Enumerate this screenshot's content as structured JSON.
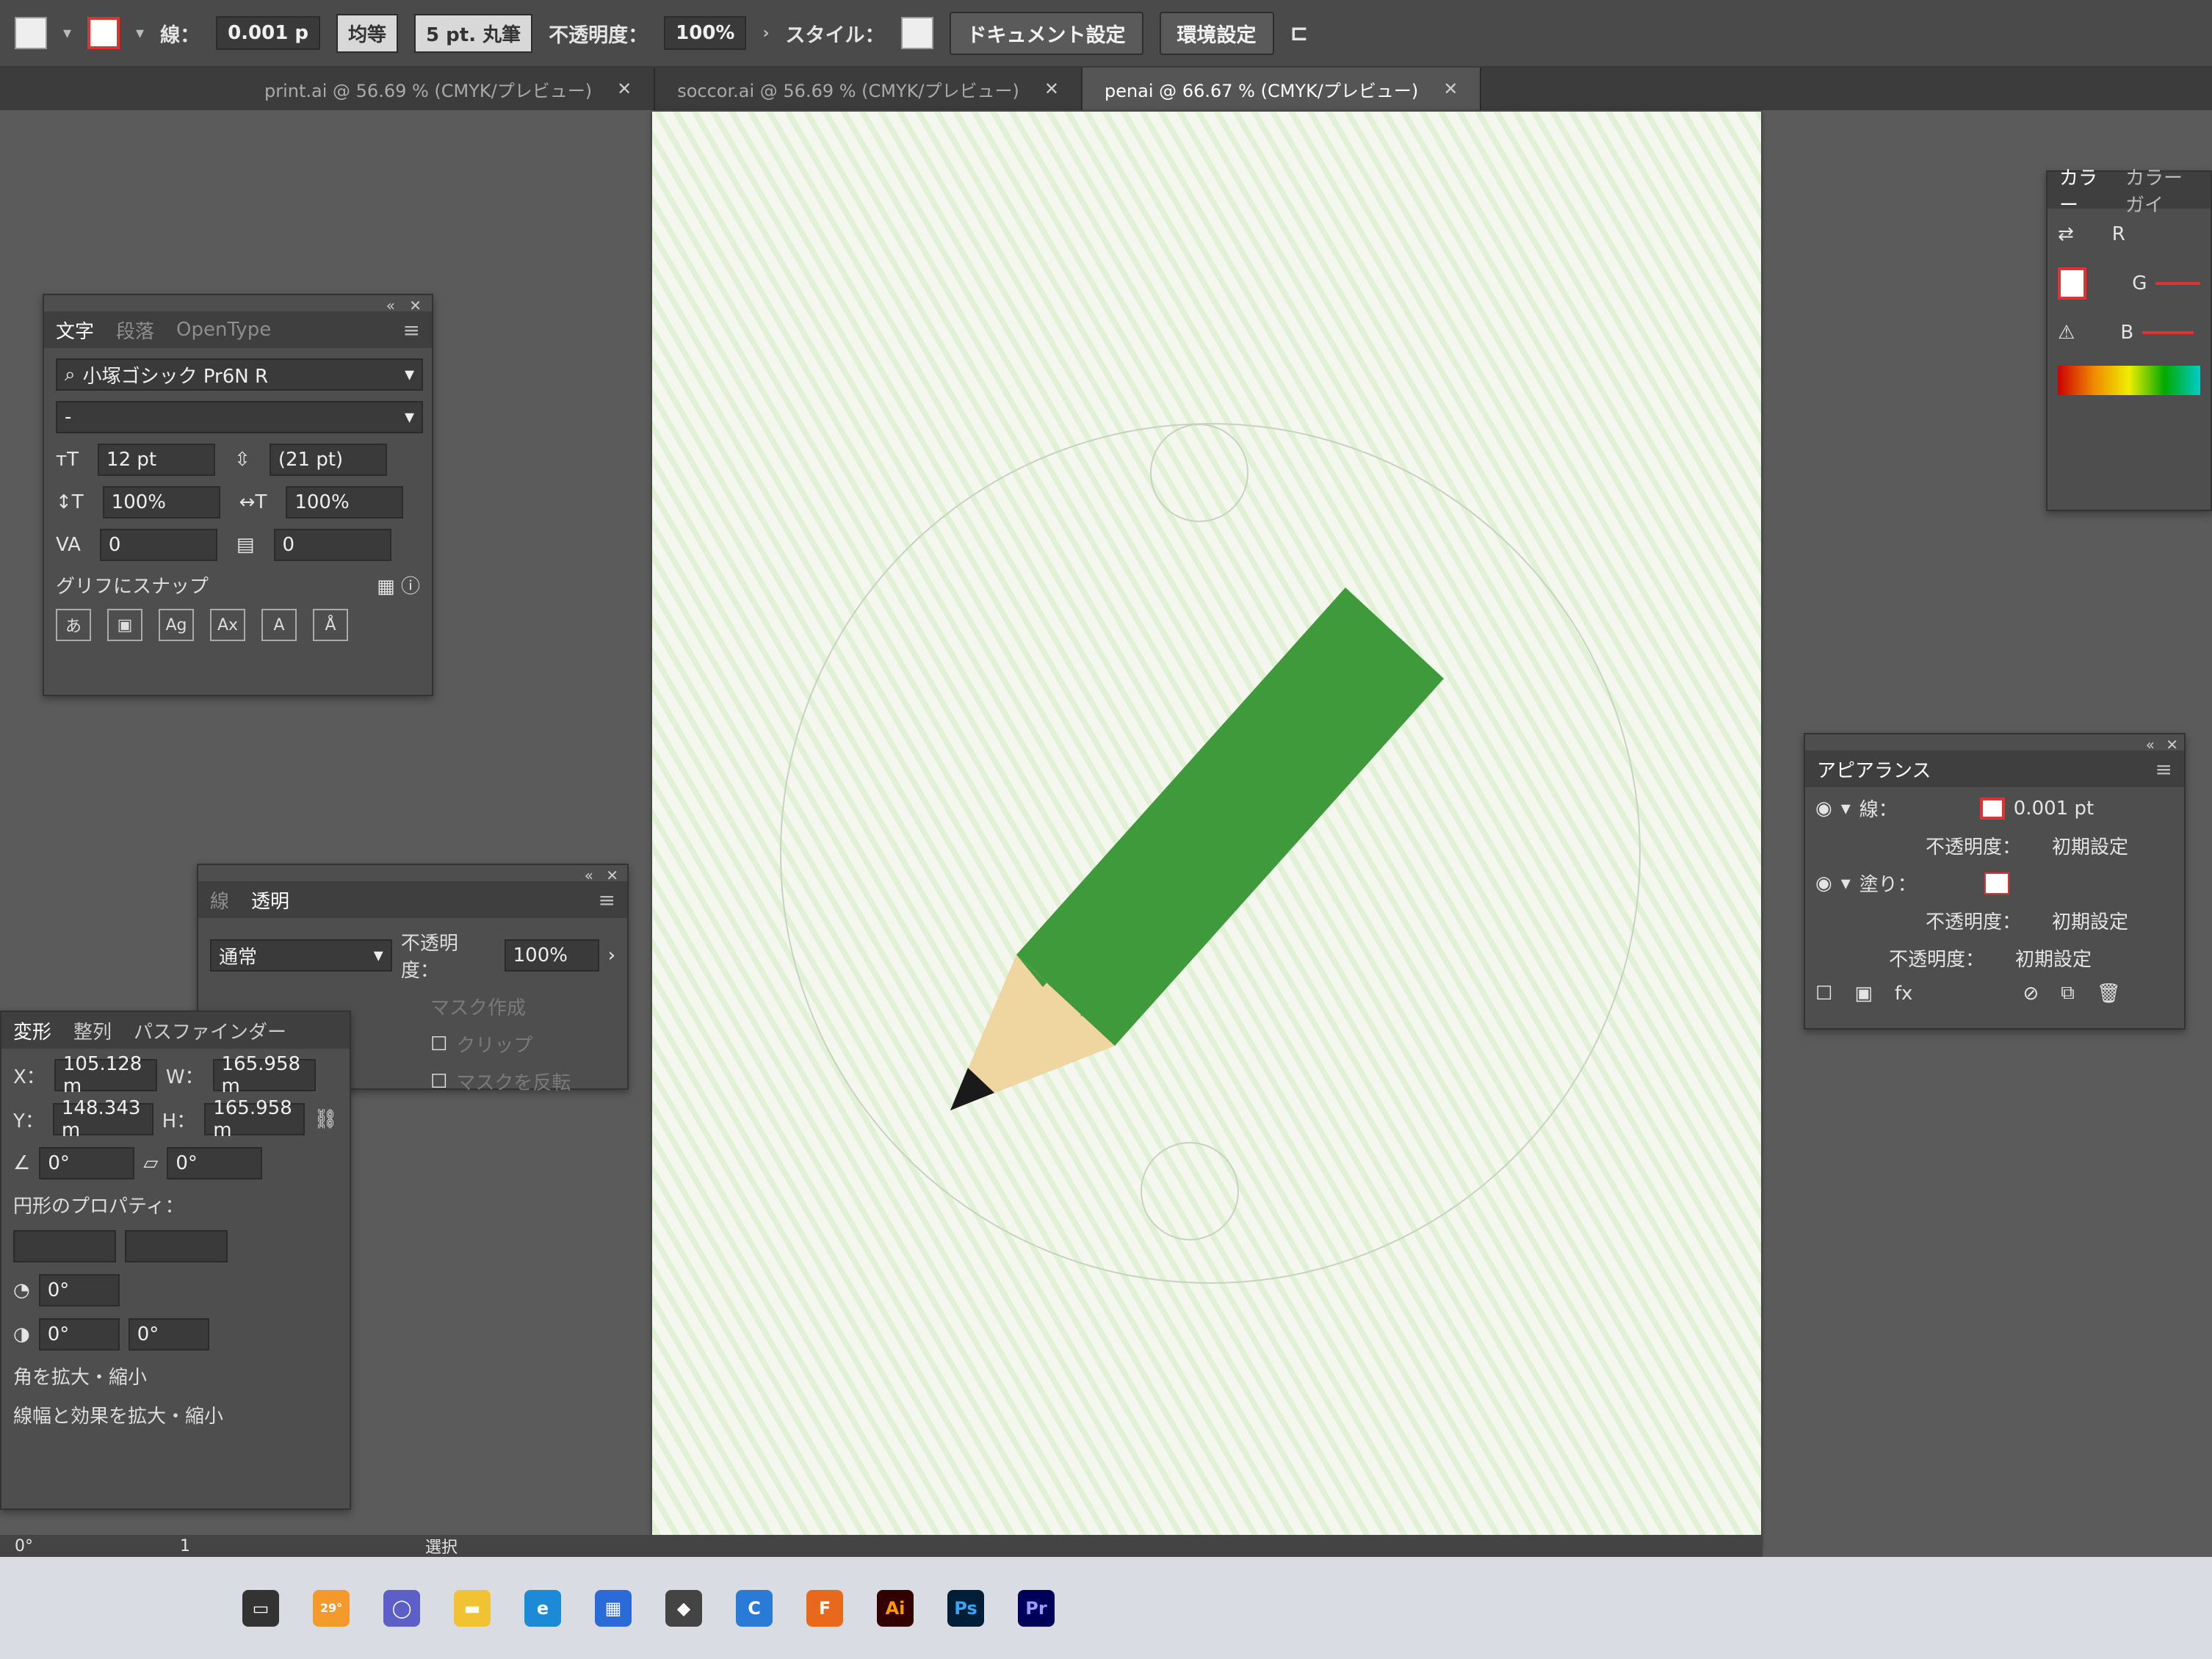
{
  "control_bar": {
    "stroke_label": "線：",
    "stroke_weight": "0.001 p",
    "profile": "均等",
    "brush": "5 pt. 丸筆",
    "opacity_label": "不透明度：",
    "opacity_value": "100%",
    "style_label": "スタイル：",
    "doc_settings_button": "ドキュメント設定",
    "preferences_button": "環境設定"
  },
  "tabs": [
    {
      "label": "print.ai @ 56.69 % (CMYK/プレビュー)"
    },
    {
      "label": "soccor.ai @ 56.69 % (CMYK/プレビュー)"
    },
    {
      "label": "penai @ 66.67 % (CMYK/プレビュー)"
    }
  ],
  "character_panel": {
    "tab_active": "文字",
    "tab_2": "段落",
    "tab_3": "OpenType",
    "font_family": "小塚ゴシック Pr6N R",
    "font_style": "-",
    "font_size": "12 pt",
    "leading": "(21 pt)",
    "vertical_scale": "100%",
    "horizontal_scale": "100%",
    "kerning": "0",
    "tracking": "0",
    "snap_label": "グリフにスナップ"
  },
  "transparency_panel": {
    "tab_stroke": "線",
    "tab_active": "透明",
    "blend_mode": "通常",
    "opacity_label": "不透明度：",
    "opacity_value": "100%",
    "mask_button": "マスク作成",
    "clip_label": "クリップ",
    "invert_label": "マスクを反転"
  },
  "transform_panel": {
    "tab_1": "変形",
    "tab_2": "整列",
    "tab_3": "パスファインダー",
    "x_label": "X：",
    "x_value": "105.128 m",
    "y_label": "Y：",
    "y_value": "148.343 m",
    "w_label": "W：",
    "w_value": "165.958 m",
    "h_label": "H：",
    "h_value": "165.958 m",
    "rotate_value": "0°",
    "shear_value": "0°",
    "ellipse_props_label": "円形のプロパティ：",
    "angle_1": "0°",
    "angle_2": "0°",
    "angle_3": "0°",
    "scale_corners_label": "角を拡大・縮小",
    "scale_strokes_label": "線幅と効果を拡大・縮小"
  },
  "color_panel": {
    "tab_active": "カラー",
    "tab_2": "カラーガイ",
    "r_label": "R",
    "g_label": "G",
    "b_label": "B"
  },
  "appearance_panel": {
    "title": "アピアランス",
    "stroke_label": "線：",
    "stroke_value": "0.001 pt",
    "opacity_label": "不透明度：",
    "opacity_default": "初期設定",
    "fill_label": "塗り：",
    "fill_opacity_label": "不透明度：",
    "fill_opacity_default": "初期設定",
    "obj_opacity_label": "不透明度：",
    "obj_opacity_default": "初期設定"
  },
  "status_bar": {
    "angle": "0°",
    "page": "1",
    "tool": "選択"
  },
  "taskbar": {
    "weather": "29°",
    "apps": [
      "Ai",
      "Ps",
      "Pr"
    ]
  },
  "colors": {
    "pencil_green": "#3f9a3c",
    "pencil_wood": "#efd5a0",
    "pencil_tip": "#1a1a1a",
    "stripe_green": "#e2f0d6"
  }
}
